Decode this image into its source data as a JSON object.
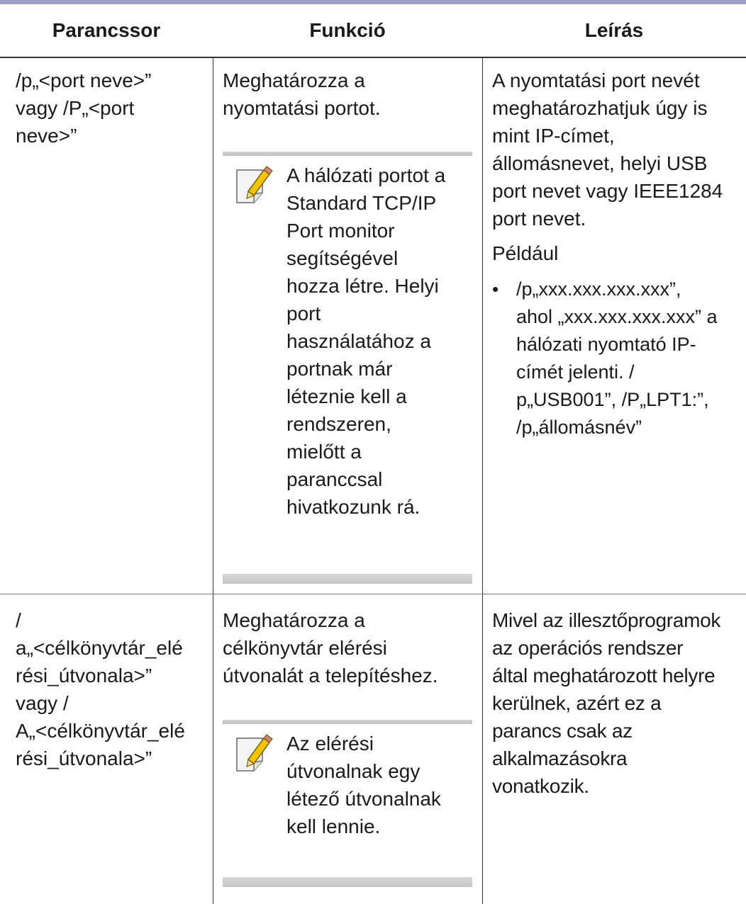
{
  "header": {
    "col1": "Parancssor",
    "col2": "Funkció",
    "col3": "Leírás"
  },
  "rows": [
    {
      "command": [
        "/p„<port neve>”",
        "vagy /P„<port",
        "neve>”"
      ],
      "function": [
        "Meghatározza a",
        "nyomtatási portot."
      ],
      "note": [
        "A hálózati portot a",
        "Standard TCP/IP",
        "Port monitor",
        "segítségével",
        "hozza létre. Helyi",
        "port",
        "használatához a",
        "portnak már",
        "léteznie kell a",
        "rendszeren,",
        "mielőtt a",
        "paranccsal",
        "hivatkozunk rá."
      ],
      "description": [
        "A nyomtatási port nevét",
        "meghatározhatjuk úgy is",
        "mint IP-címet,",
        "állomásnevet, helyi USB",
        "port nevet vagy IEEE1284",
        "port nevet."
      ],
      "example_label": "Például",
      "example_bullet": [
        "/p„xxx.xxx.xxx.xxx”,",
        "ahol „xxx.xxx.xxx.xxx” a",
        "hálózati nyomtató IP-",
        "címét jelenti. /",
        "p„USB001”, /P„LPT1:”,",
        "/p„állomásnév”"
      ]
    },
    {
      "command": [
        "/",
        "a„<célkönyvtár_elé",
        "rési_útvonala>”",
        "vagy /",
        "A„<célkönyvtár_elé",
        "rési_útvonala>”"
      ],
      "function": [
        "Meghatározza a",
        "célkönyvtár elérési",
        "útvonalát a telepítéshez."
      ],
      "note": [
        "Az elérési",
        "útvonalnak egy",
        "létező útvonalnak",
        "kell lennie."
      ],
      "description": [
        "Mivel az illesztőprogramok",
        "az operációs rendszer",
        "által meghatározott helyre",
        "kerülnek, azért ez a",
        "parancs csak az",
        "alkalmazásokra",
        "vonatkozik."
      ]
    }
  ],
  "icons": {
    "note": "note-pencil-icon"
  },
  "colors": {
    "top_bar": "#9d9dca",
    "note_bar": "#c8c8c8"
  }
}
